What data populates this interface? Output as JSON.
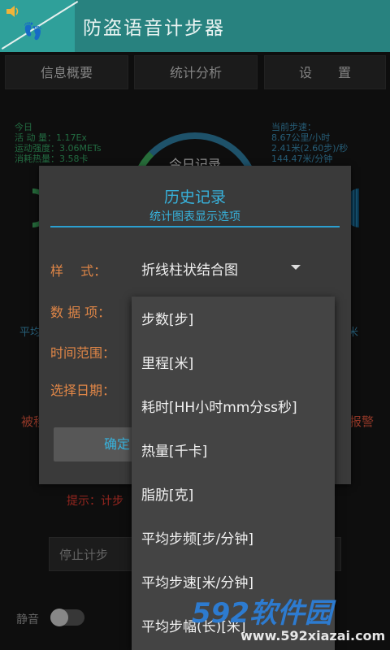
{
  "app": {
    "title": "防盗语音计步器",
    "feet_icon": "footprints-icon",
    "speaker_icon": "speaker-icon"
  },
  "tabs": [
    {
      "label": "信息概要"
    },
    {
      "label": "统计分析"
    },
    {
      "label": "设　　置"
    }
  ],
  "background": {
    "today_lines": [
      "今日",
      "活 动 量：1.17Ex",
      "运动强度：3.06METs",
      "消耗热量：3.58卡"
    ],
    "speed_lines": [
      "当前步速：",
      "8.67公里/小时",
      "2.41米(2.60步)/秒",
      "144.47米/分钟"
    ],
    "ring_text": "今日记录",
    "avg_left": "平均",
    "avg_right": "米",
    "warn_left": "被移",
    "warn_right": "报警",
    "hint": "提示：计步",
    "stop_button": "停止计步",
    "mute_label": "静音"
  },
  "dialog": {
    "title": "历史记录",
    "subtitle": "统计图表显示选项",
    "style_label": "样　 式：",
    "style_value": "折线柱状结合图",
    "data_label": "数 据 项：",
    "range_label": "时间范围：",
    "date_label": "选择日期：",
    "ok_button": "确定"
  },
  "dropdown": {
    "items": [
      "步数[步]",
      "里程[米]",
      "耗时[HH小时mm分ss秒]",
      "热量[千卡]",
      "脂肪[克]",
      "平均步频[步/分钟]",
      "平均步速[米/分钟]",
      "平均步幅(长)[米]"
    ]
  },
  "watermark": {
    "brand": "592软件园",
    "url": "www.592xiazai.com"
  },
  "colors": {
    "titlebar": "#28827f",
    "accent_blue": "#37b2dc",
    "label_orange": "#e08647",
    "warn_red": "#e23a2f"
  }
}
